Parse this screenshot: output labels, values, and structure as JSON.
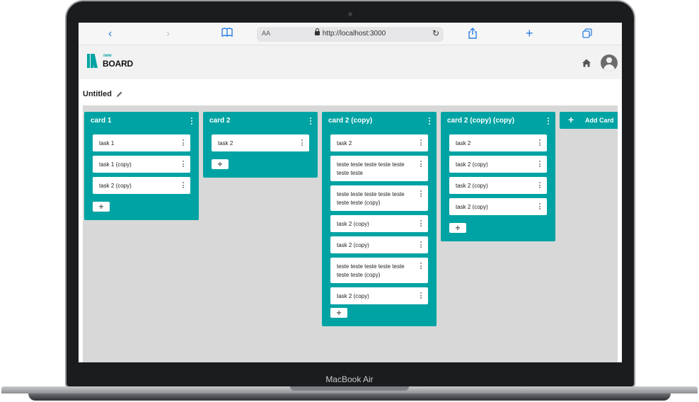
{
  "device": {
    "label": "MacBook Air"
  },
  "browser": {
    "url": "http://localhost:3000",
    "text_size_label": "AA"
  },
  "app": {
    "logo_small": "new",
    "logo_main": "BOARD",
    "accent": "#00a3a3"
  },
  "board": {
    "title": "Untitled",
    "add_card_label": "Add Card"
  },
  "columns": [
    {
      "title": "card 1",
      "tasks": [
        "task 1",
        "task 1 (copy)",
        "task 2 (copy)"
      ]
    },
    {
      "title": "card 2",
      "tasks": [
        "task 2"
      ]
    },
    {
      "title": "card 2 (copy)",
      "tasks": [
        "task 2",
        "teste teste teste teste teste teste teste",
        "teste teste teste teste teste teste teste (copy)",
        "task 2 (copy)",
        "task 2 (copy)",
        "teste teste teste teste teste teste teste (copy)",
        "task 2 (copy)"
      ]
    },
    {
      "title": "card 2 (copy) (copy)",
      "tasks": [
        "task 2",
        "task 2 (copy)",
        "task 2 (copy)",
        "task 2 (copy)"
      ]
    }
  ]
}
